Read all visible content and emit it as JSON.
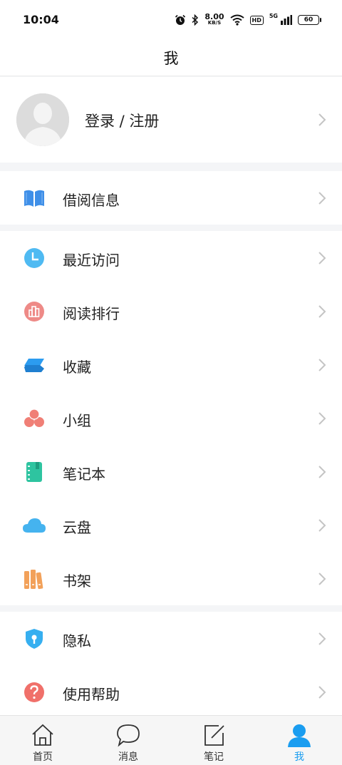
{
  "status_bar": {
    "time": "10:04",
    "net_speed_value": "8.00",
    "net_speed_unit": "KB/S",
    "hd": "HD",
    "network": "5G",
    "battery": "60"
  },
  "header": {
    "title": "我"
  },
  "profile": {
    "login_label": "登录 / 注册"
  },
  "menu_groups": [
    {
      "items": [
        {
          "label": "借阅信息",
          "icon": "book-icon",
          "color": "#3f8fe8"
        }
      ]
    },
    {
      "items": [
        {
          "label": "最近访问",
          "icon": "clock-icon",
          "color": "#4fbaf2"
        },
        {
          "label": "阅读排行",
          "icon": "ranking-icon",
          "color": "#ee8a87"
        },
        {
          "label": "收藏",
          "icon": "layers-icon",
          "color": "#2c9cf0"
        },
        {
          "label": "小组",
          "icon": "group-icon",
          "color": "#f07f76"
        },
        {
          "label": "笔记本",
          "icon": "notebook-icon",
          "color": "#2ec4a0"
        },
        {
          "label": "云盘",
          "icon": "cloud-icon",
          "color": "#45b3ef"
        },
        {
          "label": "书架",
          "icon": "bookshelf-icon",
          "color": "#f2a15a"
        }
      ]
    },
    {
      "items": [
        {
          "label": "隐私",
          "icon": "shield-icon",
          "color": "#36aff0"
        },
        {
          "label": "使用帮助",
          "icon": "help-icon",
          "color": "#f0706a"
        }
      ]
    }
  ],
  "tab_bar": {
    "tabs": [
      {
        "label": "首页",
        "icon": "home-icon"
      },
      {
        "label": "消息",
        "icon": "message-icon"
      },
      {
        "label": "笔记",
        "icon": "note-icon"
      },
      {
        "label": "我",
        "icon": "user-icon",
        "active": true
      }
    ],
    "active_color": "#1a9df0"
  }
}
